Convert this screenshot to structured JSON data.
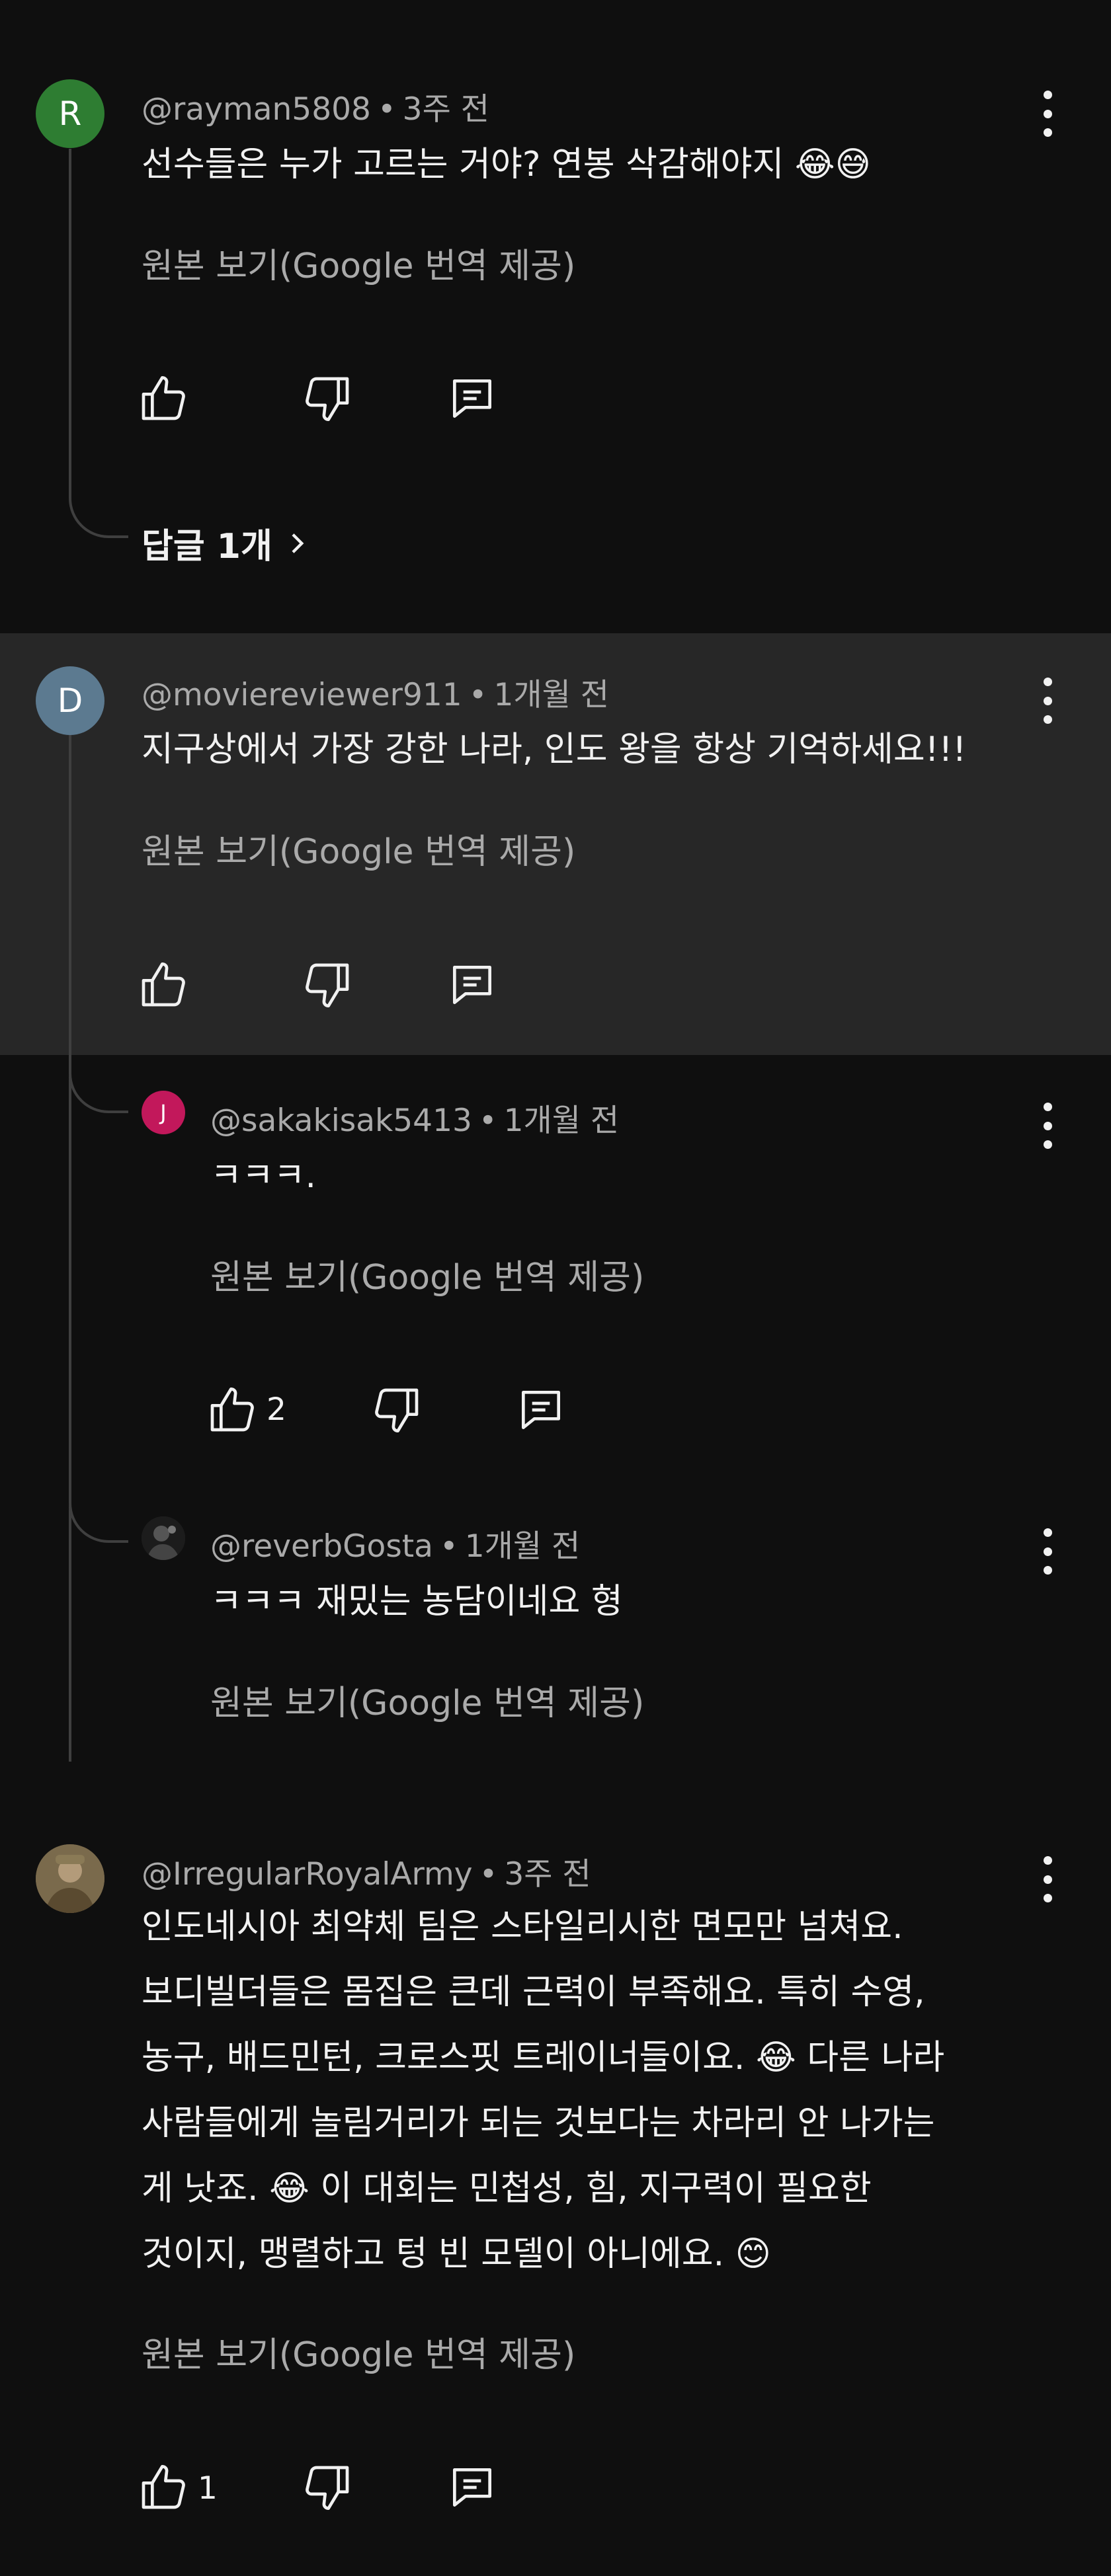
{
  "translate_label": "원본 보기(Google 번역 제공)",
  "comments": [
    {
      "avatar_letter": "R",
      "avatar_color": "#2e7d32",
      "handle": "@rayman5808",
      "time": "3주 전",
      "text": "선수들은 누가 고르는 거야? 연봉 삭감해야지 😂😅",
      "replies_label": "답글 1개",
      "likes": ""
    },
    {
      "avatar_letter": "D",
      "avatar_color": "#5c7a90",
      "handle": "@moviereviewer911",
      "time": "1개월 전",
      "text": "지구상에서 가장 강한 나라, 인도 왕을 항상 기억하세요!!!",
      "likes": "",
      "replies": [
        {
          "avatar_letter": "J",
          "avatar_color": "#c2185b",
          "handle": "@sakakisak5413",
          "time": "1개월 전",
          "text": "ㅋㅋㅋ.",
          "likes": "2"
        },
        {
          "avatar_letter": "",
          "avatar_color": "#2a2a2a",
          "handle": "@reverbGosta",
          "time": "1개월 전",
          "text": "ㅋㅋㅋ 재밌는 농담이네요 형"
        }
      ]
    },
    {
      "avatar_letter": "",
      "avatar_color": "#6b5a3e",
      "handle": "@IrregularRoyalArmy",
      "time": "3주 전",
      "lines": [
        "인도네시아 최약체 팀은 스타일리시한 면모만 넘쳐요.",
        "보디빌더들은 몸집은 큰데 근력이 부족해요. 특히 수영,",
        "농구, 배드민턴, 크로스핏 트레이너들이요. 😂 다른 나라",
        "사람들에게 놀림거리가 되는 것보다는 차라리 안 나가는",
        "게 낫죠. 😂 이 대회는 민첩성, 힘, 지구력이 필요한",
        "것이지, 맹렬하고 텅 빈 모델이 아니에요. 😊"
      ],
      "likes": "1"
    }
  ],
  "meta_separator": "•"
}
